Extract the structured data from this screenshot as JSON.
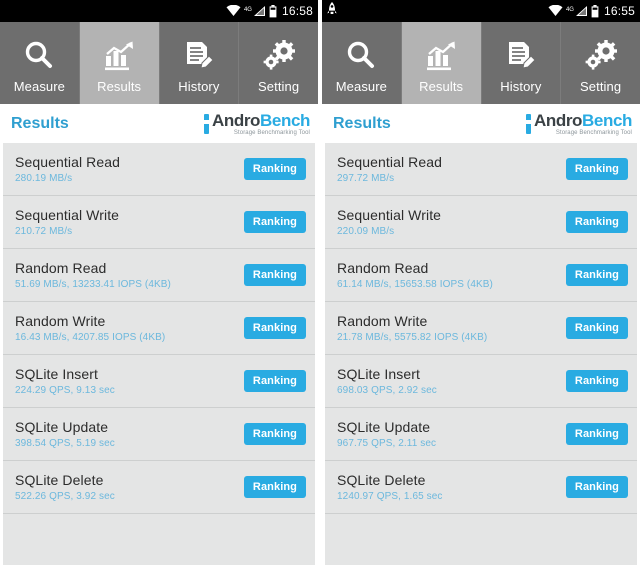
{
  "screens": [
    {
      "id": "left",
      "statusbar": {
        "time": "16:58",
        "network_label": "4G",
        "notification_icon": "",
        "icons": [
          "wifi-icon",
          "signal-icon",
          "battery-icon"
        ]
      },
      "tabs": [
        {
          "label": "Measure",
          "icon": "magnifier-icon",
          "active": false
        },
        {
          "label": "Results",
          "icon": "bar-chart-icon",
          "active": true
        },
        {
          "label": "History",
          "icon": "document-pencil-icon",
          "active": false
        },
        {
          "label": "Setting",
          "icon": "gears-icon",
          "active": false
        }
      ],
      "header": {
        "title": "Results",
        "logo_main_1": "Andro",
        "logo_main_2": "Bench",
        "logo_sub": "Storage Benchmarking Tool"
      },
      "rows": [
        {
          "title": "Sequential Read",
          "value": "280.19 MB/s",
          "button": "Ranking"
        },
        {
          "title": "Sequential Write",
          "value": "210.72 MB/s",
          "button": "Ranking"
        },
        {
          "title": "Random Read",
          "value": "51.69 MB/s, 13233.41 IOPS (4KB)",
          "button": "Ranking"
        },
        {
          "title": "Random Write",
          "value": "16.43 MB/s, 4207.85 IOPS (4KB)",
          "button": "Ranking"
        },
        {
          "title": "SQLite Insert",
          "value": "224.29 QPS, 9.13 sec",
          "button": "Ranking"
        },
        {
          "title": "SQLite Update",
          "value": "398.54 QPS, 5.19 sec",
          "button": "Ranking"
        },
        {
          "title": "SQLite Delete",
          "value": "522.26 QPS, 3.92 sec",
          "button": "Ranking"
        }
      ]
    },
    {
      "id": "right",
      "statusbar": {
        "time": "16:55",
        "network_label": "4G",
        "notification_icon": "rocket-icon",
        "icons": [
          "wifi-icon",
          "signal-icon",
          "battery-icon"
        ]
      },
      "tabs": [
        {
          "label": "Measure",
          "icon": "magnifier-icon",
          "active": false
        },
        {
          "label": "Results",
          "icon": "bar-chart-icon",
          "active": true
        },
        {
          "label": "History",
          "icon": "document-pencil-icon",
          "active": false
        },
        {
          "label": "Setting",
          "icon": "gears-icon",
          "active": false
        }
      ],
      "header": {
        "title": "Results",
        "logo_main_1": "Andro",
        "logo_main_2": "Bench",
        "logo_sub": "Storage Benchmarking Tool"
      },
      "rows": [
        {
          "title": "Sequential Read",
          "value": "297.72 MB/s",
          "button": "Ranking"
        },
        {
          "title": "Sequential Write",
          "value": "220.09 MB/s",
          "button": "Ranking"
        },
        {
          "title": "Random Read",
          "value": "61.14 MB/s, 15653.58 IOPS (4KB)",
          "button": "Ranking"
        },
        {
          "title": "Random Write",
          "value": "21.78 MB/s, 5575.82 IOPS (4KB)",
          "button": "Ranking"
        },
        {
          "title": "SQLite Insert",
          "value": "698.03 QPS, 2.92 sec",
          "button": "Ranking"
        },
        {
          "title": "SQLite Update",
          "value": "967.75 QPS, 2.11 sec",
          "button": "Ranking"
        },
        {
          "title": "SQLite Delete",
          "value": "1240.97 QPS, 1.65 sec",
          "button": "Ranking"
        }
      ]
    }
  ],
  "colors": {
    "accent": "#29abe2",
    "value_text": "#6cb8dd",
    "tab_bar": "#6e6e6e",
    "tab_active": "#b3b3b3",
    "list_bg": "#e4e5e5",
    "status_bg": "#000000"
  }
}
